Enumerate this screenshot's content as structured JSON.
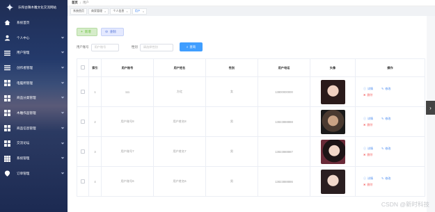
{
  "app": {
    "title": "乐和古镇木雕文化交流网站"
  },
  "sidebar": {
    "items": [
      {
        "label": "系统首页",
        "icon": "home-icon",
        "chevron": false
      },
      {
        "label": "个人中心",
        "icon": "user-icon",
        "chevron": true
      },
      {
        "label": "用户管理",
        "icon": "list-icon",
        "chevron": true
      },
      {
        "label": "创作者管理",
        "icon": "list-icon",
        "chevron": true
      },
      {
        "label": "电脑所管理",
        "icon": "grid-icon",
        "chevron": true
      },
      {
        "label": "商品分类管理",
        "icon": "grid-icon",
        "chevron": true
      },
      {
        "label": "木雕作品管理",
        "icon": "grid-icon",
        "chevron": true
      },
      {
        "label": "商品信息管理",
        "icon": "grid-icon",
        "chevron": true
      },
      {
        "label": "交流论坛",
        "icon": "grid-icon",
        "chevron": true
      },
      {
        "label": "系统管理",
        "icon": "grid-icon",
        "chevron": true
      },
      {
        "label": "订单管理",
        "icon": "location-icon",
        "chevron": true
      }
    ]
  },
  "topbar": {
    "crumb_home": "首页",
    "crumb_current": "用户"
  },
  "tabs": [
    {
      "label": "系统首页"
    },
    {
      "label": "商家管理"
    },
    {
      "label": "个人信息"
    },
    {
      "label": "用户"
    }
  ],
  "toolbar": {
    "add_label": "新增",
    "delete_label": "删除"
  },
  "filter": {
    "account_label": "用户账号",
    "account_placeholder": "用户账号",
    "gender_label": "性别",
    "gender_placeholder": "请选择性别",
    "search_label": "查询"
  },
  "table": {
    "headers": [
      "索引",
      "用户账号",
      "用户姓名",
      "性别",
      "用户电话",
      "头像",
      "操作"
    ],
    "rows": [
      {
        "index": "1",
        "account": "111",
        "name": "方红",
        "gender": "女",
        "phone": "13800000000"
      },
      {
        "index": "2",
        "account": "用户账号8",
        "name": "用户姓名8",
        "gender": "男",
        "phone": "13823888888"
      },
      {
        "index": "3",
        "account": "用户账号7",
        "name": "用户姓名7",
        "gender": "男",
        "phone": "13823888887"
      },
      {
        "index": "4",
        "account": "用户账号6",
        "name": "用户姓名6",
        "gender": "男",
        "phone": "13823888886"
      }
    ],
    "ops": {
      "detail": "详情",
      "edit": "修改",
      "delete": "删除"
    }
  },
  "watermark": "CSDN @新时科技"
}
